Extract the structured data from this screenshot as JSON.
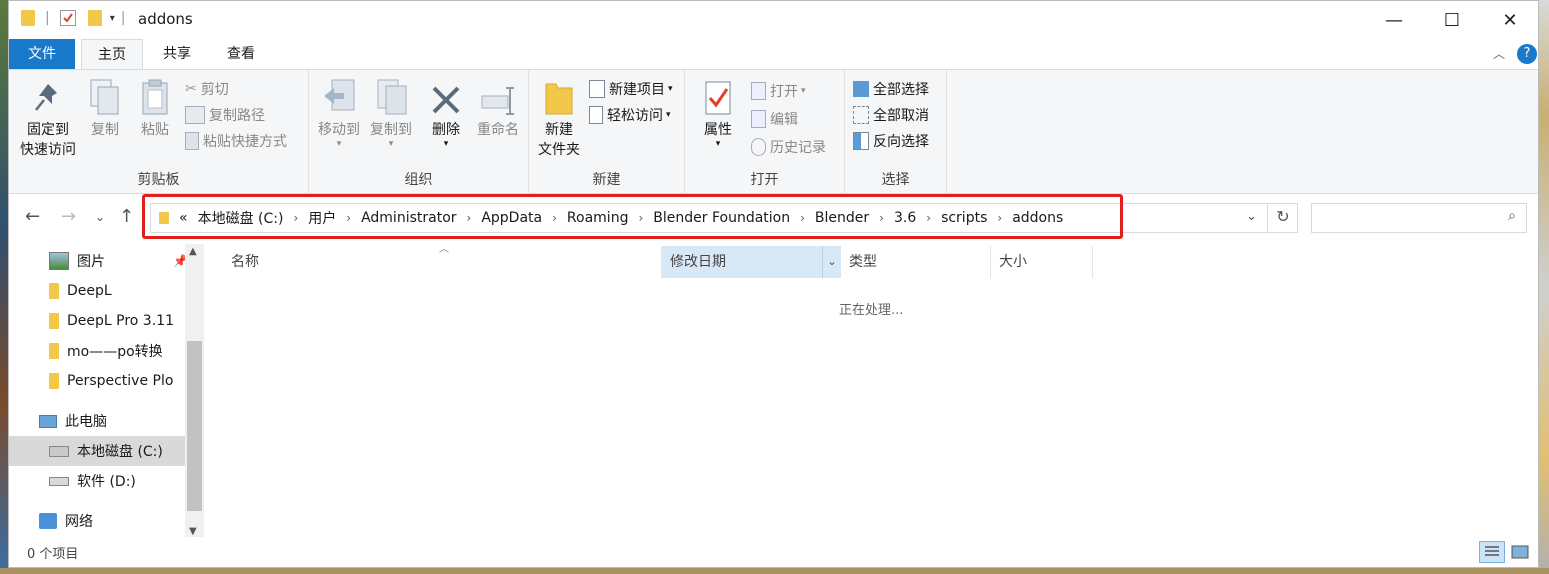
{
  "window": {
    "title": "addons"
  },
  "tabs": {
    "file": "文件",
    "home": "主页",
    "share": "共享",
    "view": "查看"
  },
  "ribbon": {
    "clipboard": {
      "pin": "固定到",
      "pin2": "快速访问",
      "copy": "复制",
      "paste": "粘贴",
      "cut": "剪切",
      "copy_path": "复制路径",
      "paste_shortcut": "粘贴快捷方式",
      "label": "剪贴板"
    },
    "organize": {
      "move_to": "移动到",
      "copy_to": "复制到",
      "delete": "删除",
      "rename": "重命名",
      "label": "组织"
    },
    "new": {
      "new_folder": "新建",
      "new_folder2": "文件夹",
      "new_item": "新建项目",
      "easy_access": "轻松访问",
      "label": "新建"
    },
    "open": {
      "properties": "属性",
      "open": "打开",
      "edit": "编辑",
      "history": "历史记录",
      "label": "打开"
    },
    "select": {
      "select_all": "全部选择",
      "select_none": "全部取消",
      "invert": "反向选择",
      "label": "选择"
    }
  },
  "address": {
    "overflow": "«",
    "crumbs": [
      "本地磁盘 (C:)",
      "用户",
      "Administrator",
      "AppData",
      "Roaming",
      "Blender Foundation",
      "Blender",
      "3.6",
      "scripts",
      "addons"
    ]
  },
  "nav": {
    "items": [
      "图片",
      "DeepL",
      "DeepL Pro 3.11",
      "mo——po转换",
      "Perspective Plo"
    ],
    "this_pc": "此电脑",
    "drive_c": "本地磁盘 (C:)",
    "drive_d": "软件 (D:)",
    "network": "网络"
  },
  "columns": {
    "name": "名称",
    "modified": "修改日期",
    "type": "类型",
    "size": "大小"
  },
  "content": {
    "processing": "正在处理..."
  },
  "status": {
    "count": "0 个项目"
  },
  "colors": {
    "accent": "#1979ca",
    "highlight": "#e0201a",
    "sort_header": "#d9e8f7"
  }
}
